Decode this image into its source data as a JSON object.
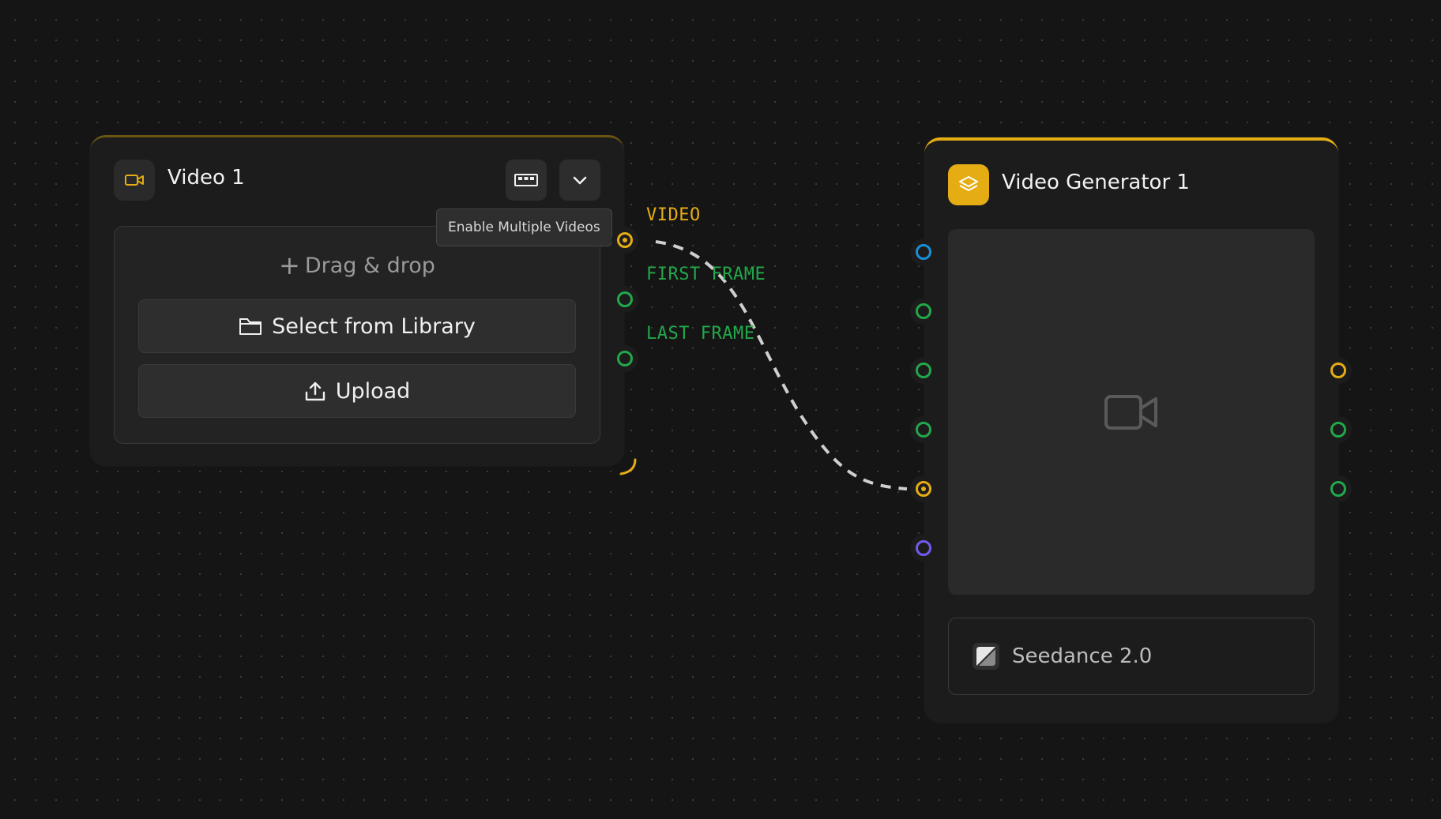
{
  "colors": {
    "accent": "#e5ac13",
    "green": "#22a84a",
    "blue": "#1a8fd6",
    "purple": "#6f5cf0",
    "connection": "#cfcfcf"
  },
  "video_node": {
    "title": "Video 1",
    "icon": "video-camera-icon",
    "multi_button_icon": "film-strip-icon",
    "collapse_icon": "chevron-down-icon",
    "tooltip": "Enable Multiple Videos",
    "drag_drop": "Drag & drop",
    "select_library": "Select from Library",
    "upload": "Upload",
    "outputs": [
      {
        "label": "VIDEO",
        "color": "#e5ac13"
      },
      {
        "label": "FIRST FRAME",
        "color": "#22a84a"
      },
      {
        "label": "LAST FRAME",
        "color": "#22a84a"
      }
    ]
  },
  "generator_node": {
    "title": "Video Generator 1",
    "icon": "layers-icon",
    "preview_icon": "video-camera-icon",
    "model": "Seedance 2.0",
    "inputs": [
      "#1a8fd6",
      "#22a84a",
      "#22a84a",
      "#22a84a",
      "#e5ac13",
      "#6f5cf0"
    ],
    "outputs": [
      "#e5ac13",
      "#22a84a",
      "#22a84a"
    ]
  }
}
